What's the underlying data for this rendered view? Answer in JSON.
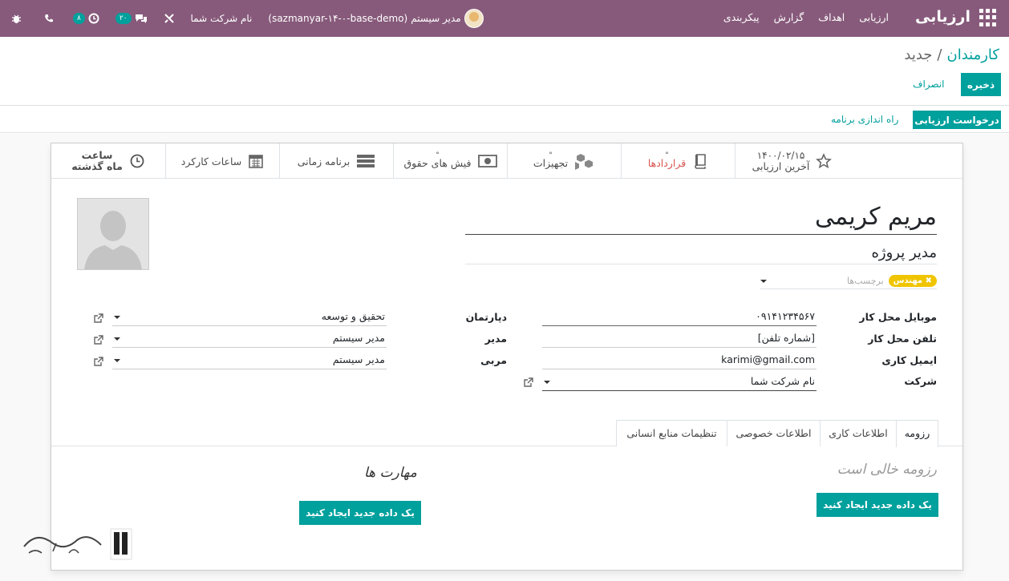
{
  "navbar": {
    "brand": "ارزیابی",
    "menu": [
      "ارزیابی",
      "اهداف",
      "گزارش",
      "پیکربندی"
    ],
    "db_name": "(sazmanyar-۱۴-۰-base-demo)",
    "user_name": "مدیر سیستم",
    "company_name": "نام شرکت شما",
    "messages_count": "۲۰",
    "activities_count": "۸"
  },
  "breadcrumb": {
    "parent": "کارمندان",
    "separator": "/",
    "current": "جدید"
  },
  "buttons": {
    "save": "ذخیره",
    "discard": "انصراف",
    "request_appraisal": "درخواست ارزیابی",
    "launch_plan": "راه اندازی برنامه"
  },
  "smart_buttons": {
    "last_appraisal_value": "۱۴۰۰/۰۲/۱۵",
    "last_appraisal_label": "آخرین ارزیابی",
    "contracts": "قراردادها",
    "equipment": "تجهیزات",
    "payslips": "فیش های حقوق",
    "schedule": "برنامه زمانی",
    "timesheet": "ساعات کارکرد",
    "hours_value": "ساعت",
    "hours_label": "ماه گذشته"
  },
  "employee": {
    "name": "مریم کریمی",
    "job_title": "مدیر پروژه",
    "tag": "مهندس",
    "tags_placeholder": "برچسب‌ها"
  },
  "fields": {
    "mobile_label": "موبایل محل کار",
    "mobile_value": "۰۹۱۴۱۲۳۴۵۶۷",
    "phone_label": "تلفن محل کار",
    "phone_value": "[شماره تلفن]",
    "email_label": "ایمیل کاری",
    "email_value": "karimi@gmail.com",
    "company_label": "شرکت",
    "company_value": "نام شرکت شما",
    "department_label": "دپارتمان",
    "department_value": "تحقیق و توسعه",
    "manager_label": "مدیر",
    "manager_value": "مدیر سیستم",
    "coach_label": "مربی",
    "coach_value": "مدیر سیستم"
  },
  "tabs": [
    "رزومه",
    "اطلاعات کاری",
    "اطلاعات خصوصی",
    "تنظیمات منابع انسانی"
  ],
  "resume": {
    "empty": "رزومه خالی است",
    "create": "یک داده جدید ایجاد کنید"
  },
  "skills": {
    "title": "مهارت ها",
    "create": "یک داده جدید ایجاد کنید"
  },
  "colors": {
    "navbar": "#875a7b",
    "primary": "#00a09d",
    "tag": "#f0c500"
  }
}
